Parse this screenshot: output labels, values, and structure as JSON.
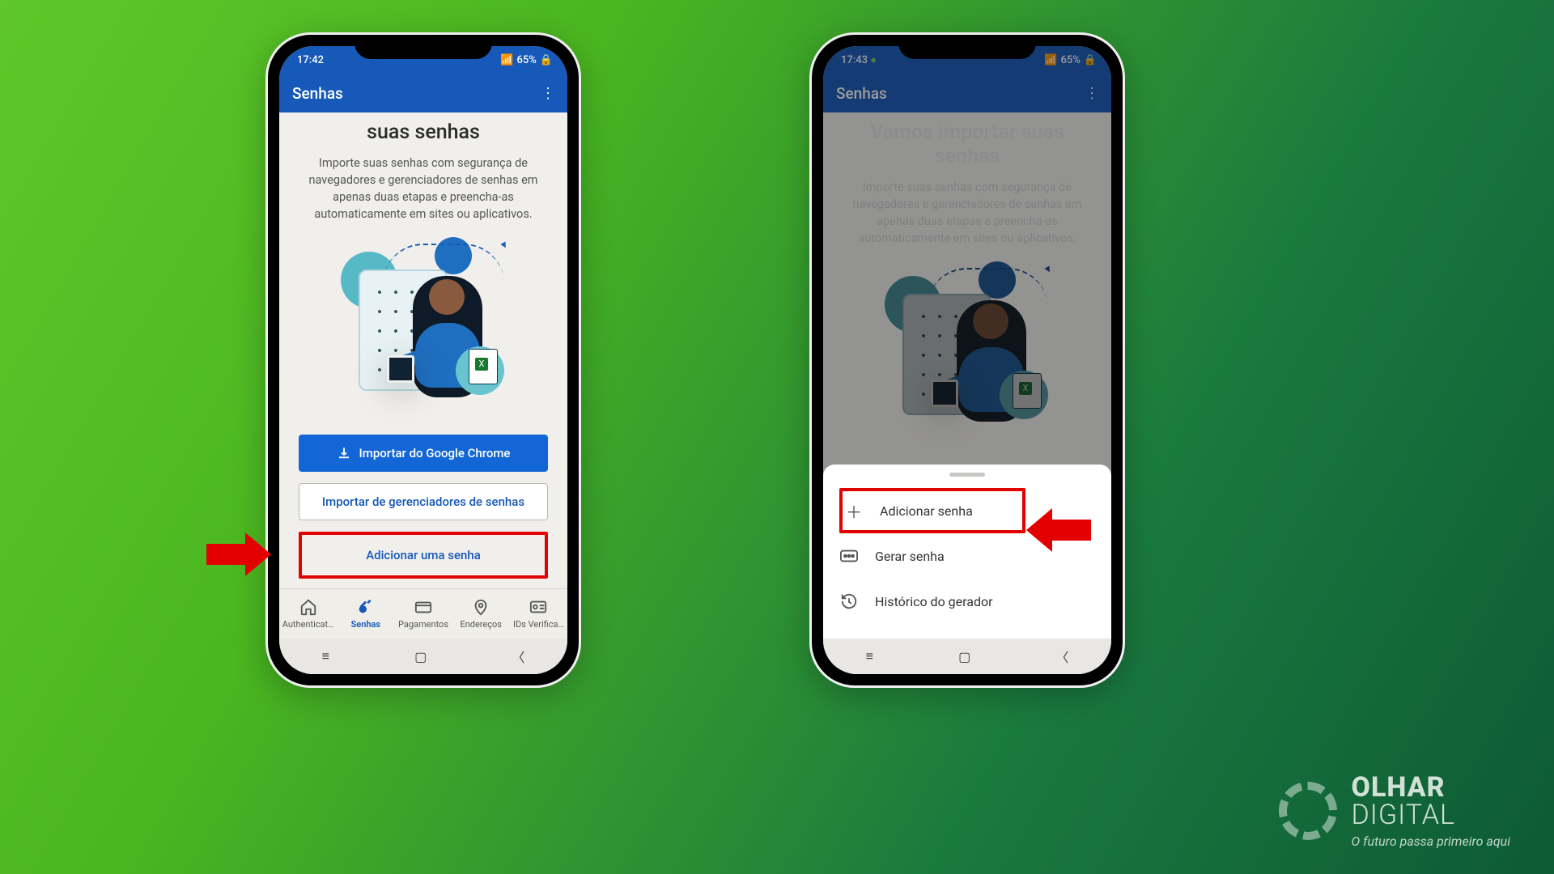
{
  "status": {
    "time_left": "17:42",
    "time_right": "17:43",
    "battery": "65%",
    "whatsapp_icon": "whatsapp"
  },
  "appbar": {
    "title": "Senhas",
    "menu_aria": "Mais opções"
  },
  "hero_left": {
    "title": "suas senhas",
    "desc": "Importe suas senhas com segurança de navegadores e gerenciadores de senhas em apenas duas etapas e preencha-as automaticamente em sites ou aplicativos."
  },
  "hero_right": {
    "title": "Vamos importar suas senhas",
    "desc": "Importe suas senhas com segurança de navegadores e gerenciadores de senhas em apenas duas etapas e preencha-as automaticamente em sites ou aplicativos."
  },
  "buttons": {
    "import_chrome": "Importar do Google Chrome",
    "import_managers": "Importar de gerenciadores de senhas",
    "add_password": "Adicionar uma senha"
  },
  "tabs": [
    {
      "id": "authenticator",
      "label": "Authenticat…"
    },
    {
      "id": "senhas",
      "label": "Senhas"
    },
    {
      "id": "pagamentos",
      "label": "Pagamentos"
    },
    {
      "id": "enderecos",
      "label": "Endereços"
    },
    {
      "id": "ids",
      "label": "IDs Verifica…"
    }
  ],
  "sheet": {
    "add": "Adicionar senha",
    "generate": "Gerar senha",
    "history": "Histórico do gerador"
  },
  "brand": {
    "line1": "OLHAR",
    "line2": "DIGITAL",
    "tag": "O futuro passa primeiro aqui"
  }
}
